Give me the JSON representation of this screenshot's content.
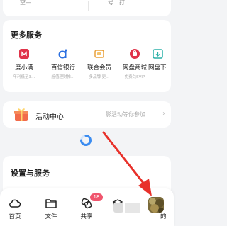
{
  "top_card": {
    "left_text": "…空—…",
    "right_text": "…号…打…"
  },
  "services": {
    "title": "更多服务",
    "items": [
      {
        "name": "度小满",
        "sub": "年利低至3…"
      },
      {
        "name": "百信银行",
        "sub": "超值理财推…"
      },
      {
        "name": "联合会员",
        "sub": "多品牌 更…"
      },
      {
        "name": "网盘商城",
        "sub": "免费兑SVIP"
      },
      {
        "name": "网盘下",
        "sub": ""
      }
    ]
  },
  "activity": {
    "title": "活动中心",
    "hint": "影活动等你参加",
    "chevron": "›"
  },
  "settings": {
    "title": "设置与服务"
  },
  "tabbar": {
    "tabs": [
      {
        "label": "首页",
        "icon": "cloud-icon"
      },
      {
        "label": "文件",
        "icon": "folder-icon"
      },
      {
        "label": "共享",
        "icon": "share-icon",
        "badge": "18"
      },
      {
        "label": "",
        "icon": "blurred-icon"
      },
      {
        "label": "",
        "icon": "avatar"
      }
    ],
    "mine_partial": "的"
  },
  "colors": {
    "accent_red": "#e0344a",
    "arrow": "#e8302a",
    "badge": "#f0556d",
    "spinner": "#3b8cf0"
  }
}
